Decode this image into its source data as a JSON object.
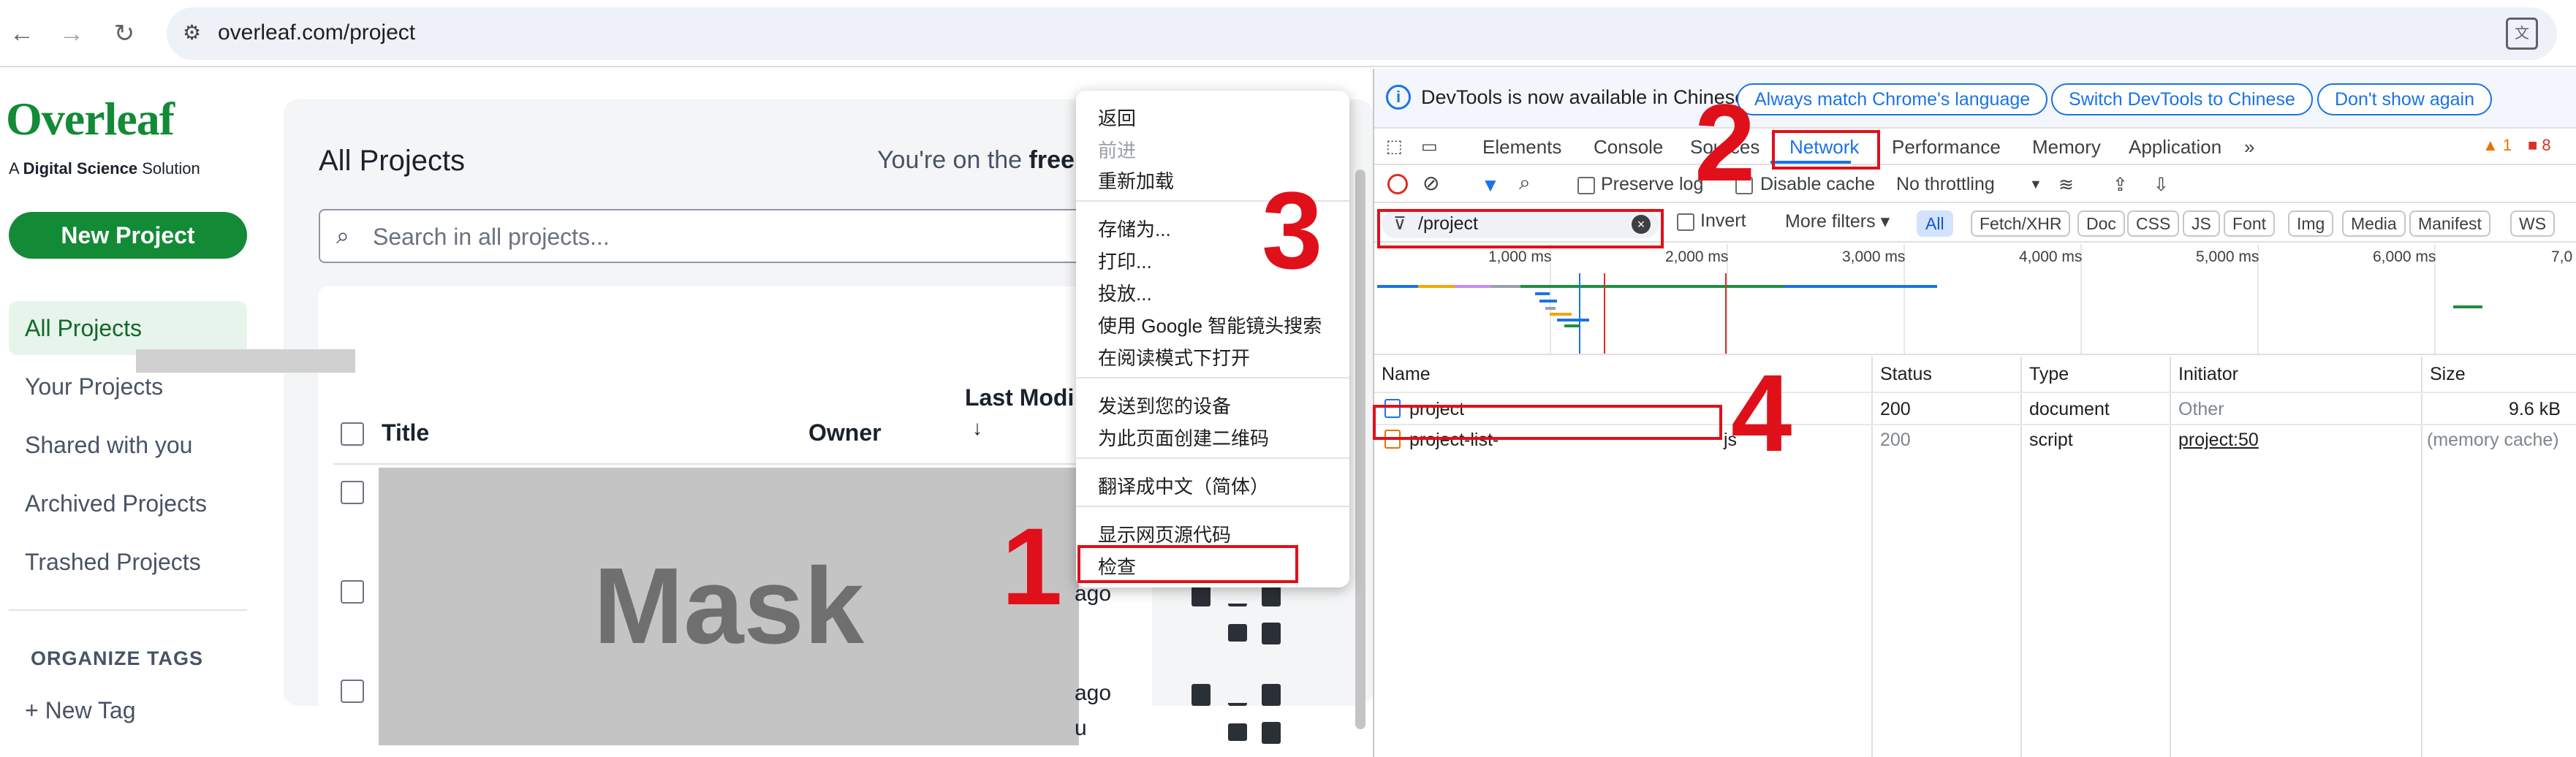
{
  "browser": {
    "url": "overleaf.com/project",
    "back_icon": "←",
    "forward_icon": "→",
    "reload_icon": "↻",
    "site_info_icon": "⚙",
    "translate_icon": "文"
  },
  "overleaf": {
    "logo_text": "Overleaf",
    "logo_sub_prefix": "A ",
    "logo_sub_bold": "Digital Science",
    "logo_sub_suffix": " Solution",
    "new_project": "New Project",
    "sidebar": [
      "All Projects",
      "Your Projects",
      "Shared with you",
      "Archived Projects",
      "Trashed Projects"
    ],
    "organize_tags": "ORGANIZE TAGS",
    "new_tag": "New Tag",
    "title": "All Projects",
    "free_plan_prefix": "You're on the ",
    "free_plan_bold": "free",
    "search_placeholder": "Search in all projects...",
    "columns": {
      "title": "Title",
      "owner": "Owner",
      "last_modified": "Last Modi",
      "sort_icon": "↓"
    },
    "rows": [
      {
        "time": "ago"
      },
      {
        "time": "ago",
        "owner_partial": "u"
      }
    ],
    "mask_label": "Mask"
  },
  "context_menu": {
    "items": [
      "返回",
      "前进",
      "重新加载",
      "存储为...",
      "打印...",
      "投放...",
      "使用 Google 智能镜头搜索",
      "在阅读模式下打开",
      "发送到您的设备",
      "为此页面创建二维码",
      "翻译成中文（简体）",
      "显示网页源代码",
      "检查"
    ]
  },
  "devtools": {
    "info_message": "DevTools is now available in Chinese!",
    "info_buttons": [
      "Always match Chrome's language",
      "Switch DevTools to Chinese",
      "Don't show again"
    ],
    "tabs": [
      "Elements",
      "Console",
      "Sources",
      "Network",
      "Performance",
      "Memory",
      "Application"
    ],
    "more_tabs_icon": "»",
    "warnings": "1",
    "errors": "8",
    "toolbar": {
      "preserve_log": "Preserve log",
      "disable_cache": "Disable cache",
      "throttling": "No throttling"
    },
    "filter": {
      "value": "/project",
      "invert": "Invert",
      "more_filters": "More filters ▾"
    },
    "type_filters": [
      "All",
      "Fetch/XHR",
      "Doc",
      "CSS",
      "JS",
      "Font",
      "Img",
      "Media",
      "Manifest",
      "WS"
    ],
    "timeline_ticks": [
      "1,000 ms",
      "2,000 ms",
      "3,000 ms",
      "4,000 ms",
      "5,000 ms",
      "6,000 ms",
      "7,0"
    ],
    "columns": [
      "Name",
      "Status",
      "Type",
      "Initiator",
      "Size"
    ],
    "requests": [
      {
        "name": "project",
        "status": "200",
        "type": "document",
        "initiator": "Other",
        "size": "9.6 kB"
      },
      {
        "name_prefix": "project-list-",
        "name_suffix": "js",
        "status": "200",
        "type": "script",
        "initiator": "project:50",
        "size": "(memory cache)"
      }
    ]
  },
  "annotations": [
    "1",
    "2",
    "3",
    "4"
  ],
  "colors": {
    "overleaf_green": "#138a36",
    "devtools_blue": "#1a73e8",
    "annotation_red": "#e0101a"
  }
}
